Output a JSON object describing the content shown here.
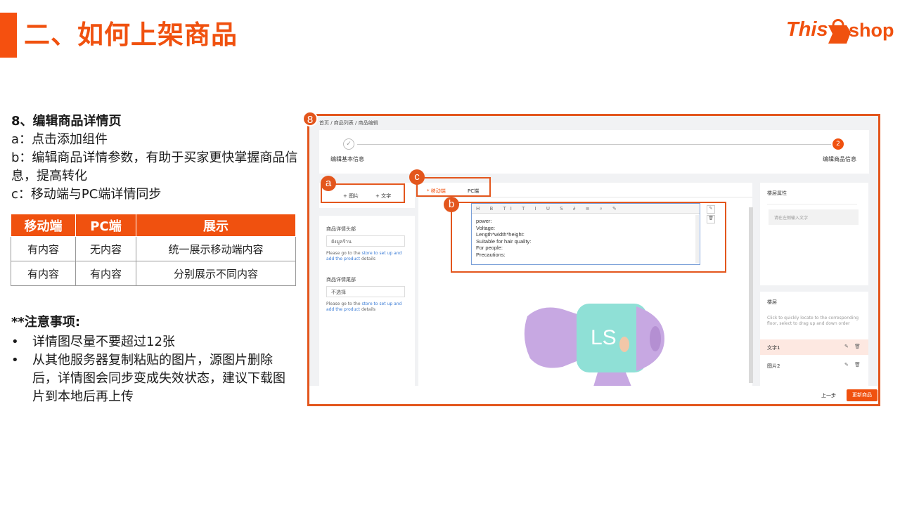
{
  "page": {
    "title": "二、如何上架商品",
    "logo": {
      "left": "This",
      "right": "shop"
    }
  },
  "instructions": {
    "step_title": "8、编辑商品详情页",
    "items": [
      "a：点击添加组件",
      "b：编辑商品详情参数，有助于买家更快掌握商品信息，提高转化",
      "c：移动端与PC端详情同步"
    ]
  },
  "table": {
    "headers": [
      "移动端",
      "PC端",
      "展示"
    ],
    "rows": [
      [
        "有内容",
        "无内容",
        "统一展示移动端内容"
      ],
      [
        "有内容",
        "有内容",
        "分别展示不同内容"
      ]
    ]
  },
  "notes": {
    "title": "**注意事项:",
    "bullet": "•",
    "items": [
      "详情图尽量不要超过12张",
      "从其他服务器复制粘贴的图片，源图片删除后，详情图会同步变成失效状态，建议下载图片到本地后再上传"
    ]
  },
  "screenshot": {
    "badges": {
      "main": "8",
      "a": "a",
      "b": "b",
      "c": "c"
    },
    "breadcrumb": "首页 / 商品列表 / 商品编辑",
    "steps": {
      "done_mark": "✓",
      "current_num": "2",
      "step1": "编辑基本信息",
      "step2": "编辑商品信息"
    },
    "add_buttons": {
      "image": "+ 图片",
      "text": "+ 文字"
    },
    "tabs": {
      "mobile": "* 移动端",
      "pc": "PC端"
    },
    "toolbar_icons": "H B TI T I U S ∂ ≡ ⌕ ✎",
    "editor_lines": [
      "power:",
      "Voltage:",
      "Length*width*height:",
      "Suitable for hair quality:",
      "For people:",
      "Precautions:"
    ],
    "header_section": {
      "label": "商品详情头部",
      "value": "ยังมูลร้าน",
      "hint_pre": "Please go to the ",
      "hint_link": "store to set up and add the product",
      "hint_post": " details"
    },
    "footer_section": {
      "label": "商品详情尾部",
      "value": "不选择",
      "hint_pre": "Please go to the ",
      "hint_link": "store to set up and add the product",
      "hint_post": " details"
    },
    "props_panel": {
      "title": "楼层属性",
      "placeholder": "请在左侧输入文字"
    },
    "floor_panel": {
      "title": "楼层",
      "hint": "Click to quickly locate to the corresponding floor, select to drag up and down order",
      "items": [
        "文字1",
        "图片2"
      ]
    },
    "product_brand": "LS",
    "footer": {
      "prev": "上一步",
      "next": "更新商品"
    }
  },
  "colors": {
    "accent": "#f0510f",
    "frame": "#e3561d",
    "link": "#3a7bd5"
  }
}
